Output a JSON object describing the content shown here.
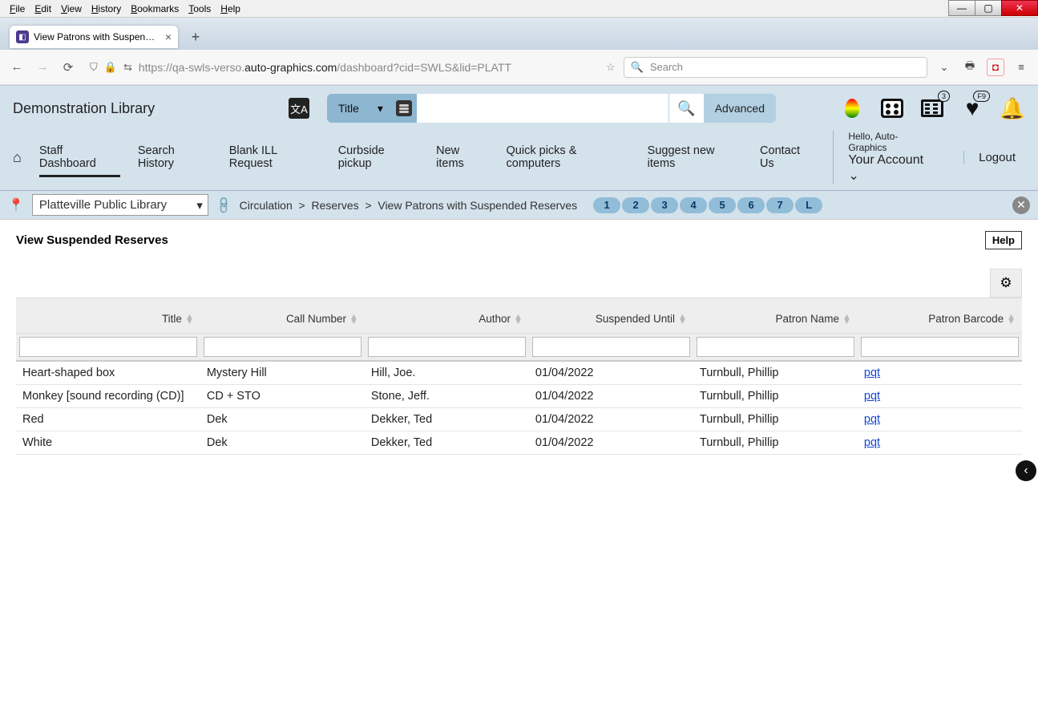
{
  "browser": {
    "menus": [
      "File",
      "Edit",
      "View",
      "History",
      "Bookmarks",
      "Tools",
      "Help"
    ],
    "tab_title": "View Patrons with Suspended R",
    "url_prefix": "https://qa-swls-verso.",
    "url_domain": "auto-graphics.com",
    "url_suffix": "/dashboard?cid=SWLS&lid=PLATT",
    "search_placeholder": "Search"
  },
  "header": {
    "library_name": "Demonstration Library",
    "search_type": "Title",
    "advanced_label": "Advanced",
    "news_badge": "3",
    "heart_badge": "F9"
  },
  "account": {
    "greeting": "Hello, Auto-Graphics",
    "label": "Your Account",
    "logout": "Logout"
  },
  "nav": {
    "items": [
      "Staff Dashboard",
      "Search History",
      "Blank ILL Request",
      "Curbside pickup",
      "New items",
      "Quick picks & computers",
      "Suggest new items",
      "Contact Us"
    ]
  },
  "crumb": {
    "location": "Platteville Public Library",
    "path": [
      "Circulation",
      "Reserves",
      "View Patrons with Suspended Reserves"
    ],
    "pills": [
      "1",
      "2",
      "3",
      "4",
      "5",
      "6",
      "7",
      "L"
    ]
  },
  "page": {
    "title": "View Suspended Reserves",
    "help": "Help"
  },
  "table": {
    "headers": [
      "Title",
      "Call Number",
      "Author",
      "Suspended Until",
      "Patron Name",
      "Patron Barcode"
    ],
    "rows": [
      {
        "title": "Heart-shaped box",
        "call": "Mystery Hill",
        "author": "Hill, Joe.",
        "until": "01/04/2022",
        "patron": "Turnbull, Phillip",
        "barcode": "pqt"
      },
      {
        "title": "Monkey [sound recording (CD)]",
        "call": "CD + STO",
        "author": "Stone, Jeff.",
        "until": "01/04/2022",
        "patron": "Turnbull, Phillip",
        "barcode": "pqt"
      },
      {
        "title": "Red",
        "call": "Dek",
        "author": "Dekker, Ted",
        "until": "01/04/2022",
        "patron": "Turnbull, Phillip",
        "barcode": "pqt"
      },
      {
        "title": "White",
        "call": "Dek",
        "author": "Dekker, Ted",
        "until": "01/04/2022",
        "patron": "Turnbull, Phillip",
        "barcode": "pqt"
      }
    ]
  }
}
